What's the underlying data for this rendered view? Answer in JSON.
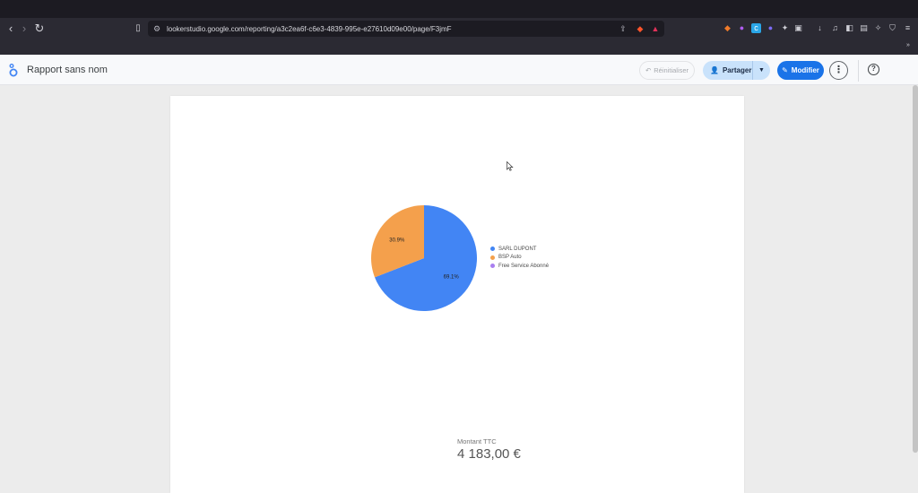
{
  "browser": {
    "url": "lookerstudio.google.com/reporting/a3c2ea6f-c6e3-4839-995e-e27610d09e00/page/F3jmF"
  },
  "app": {
    "title": "Rapport sans nom",
    "reset_label": "Réinitialiser",
    "share_label": "Partager",
    "edit_label": "Modifier",
    "more_label": "⋮",
    "help_label": "?"
  },
  "chart_data": {
    "type": "pie",
    "categories": [
      "SARL DUPONT",
      "BSP Auto",
      "Free Service Abonné"
    ],
    "values": [
      69.1,
      30.9,
      0
    ],
    "labels": [
      "69.1%",
      "30.9%",
      ""
    ],
    "colors": [
      "#4285f4",
      "#f4a04c",
      "#a97ff0"
    ],
    "legend_position": "right"
  },
  "scorecard": {
    "label": "Montant TTC",
    "value": "4 183,00 €"
  }
}
